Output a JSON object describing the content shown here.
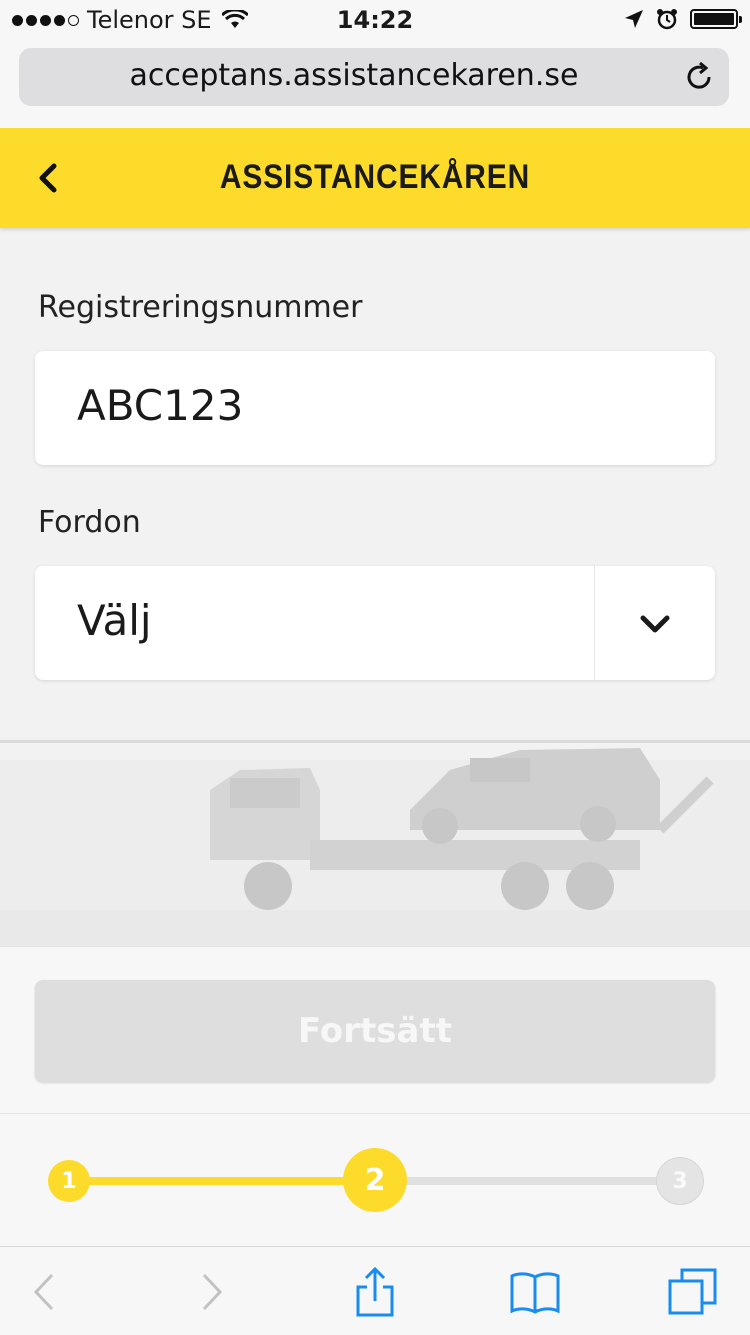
{
  "status_bar": {
    "signal_icon": "signal-dots-icon",
    "carrier": "Telenor SE",
    "wifi_icon": "wifi-icon",
    "time": "14:22",
    "location_icon": "location-arrow-icon",
    "alarm_icon": "alarm-clock-icon",
    "battery_icon": "battery-icon"
  },
  "browser": {
    "url": "acceptans.assistancekaren.se",
    "reload_icon": "reload-icon"
  },
  "header": {
    "back_icon": "chevron-left-icon",
    "brand": "ASSISTANCEKÅREN",
    "background": "#fddb2b"
  },
  "form": {
    "reg_label": "Registreringsnummer",
    "reg_value": "ABC123",
    "vehicle_label": "Fordon",
    "vehicle_selected": "Välj",
    "dropdown_icon": "chevron-down-icon"
  },
  "continue_button": {
    "label": "Fortsätt",
    "state": "disabled"
  },
  "progress": {
    "current_step": 2,
    "total_steps": 3,
    "steps": [
      "1",
      "2",
      "3"
    ],
    "active_color": "#fddb2b",
    "inactive_color": "#e0e0e0"
  },
  "toolbar": {
    "icons": [
      "back-icon",
      "forward-icon",
      "share-icon",
      "bookmarks-icon",
      "tabs-icon"
    ]
  }
}
